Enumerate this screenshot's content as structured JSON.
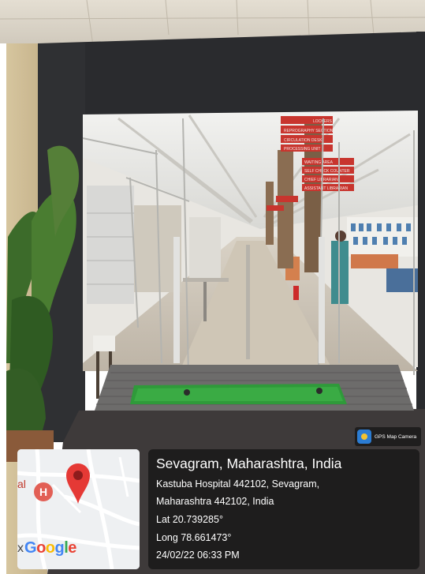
{
  "photo": {
    "scene": "library-entrance-glass-doors",
    "signage_lines": [
      "LOCKERS",
      "REPROGRAPHY SECTION",
      "CIRCULATION DESK",
      "PROCESSING UNIT",
      "WAITING AREA",
      "SELF CHECK COUNTER",
      "CHIEF LIBRARIAN",
      "ASSISTANT LIBRARIAN"
    ]
  },
  "badge": {
    "label": "GPS Map Camera",
    "icon": "map-pin-app-icon"
  },
  "map": {
    "marker_icon": "red-map-pin-icon",
    "poi_icon": "hospital-h-icon",
    "poi_letter": "H",
    "edge_label_left": "al",
    "edge_label_bottom": "x",
    "brand": [
      {
        "ch": "G",
        "color": "#4285F4"
      },
      {
        "ch": "o",
        "color": "#EA4335"
      },
      {
        "ch": "o",
        "color": "#FBBC05"
      },
      {
        "ch": "g",
        "color": "#4285F4"
      },
      {
        "ch": "l",
        "color": "#34A853"
      },
      {
        "ch": "e",
        "color": "#EA4335"
      }
    ]
  },
  "location": {
    "title": "Sevagram, Maharashtra, India",
    "address_line1": "Kastuba Hospital 442102, Sevagram,",
    "address_line2": "Maharashtra 442102, India",
    "lat": "Lat 20.739285°",
    "long": "Long 78.661473°",
    "datetime": "24/02/22 06:33 PM"
  }
}
